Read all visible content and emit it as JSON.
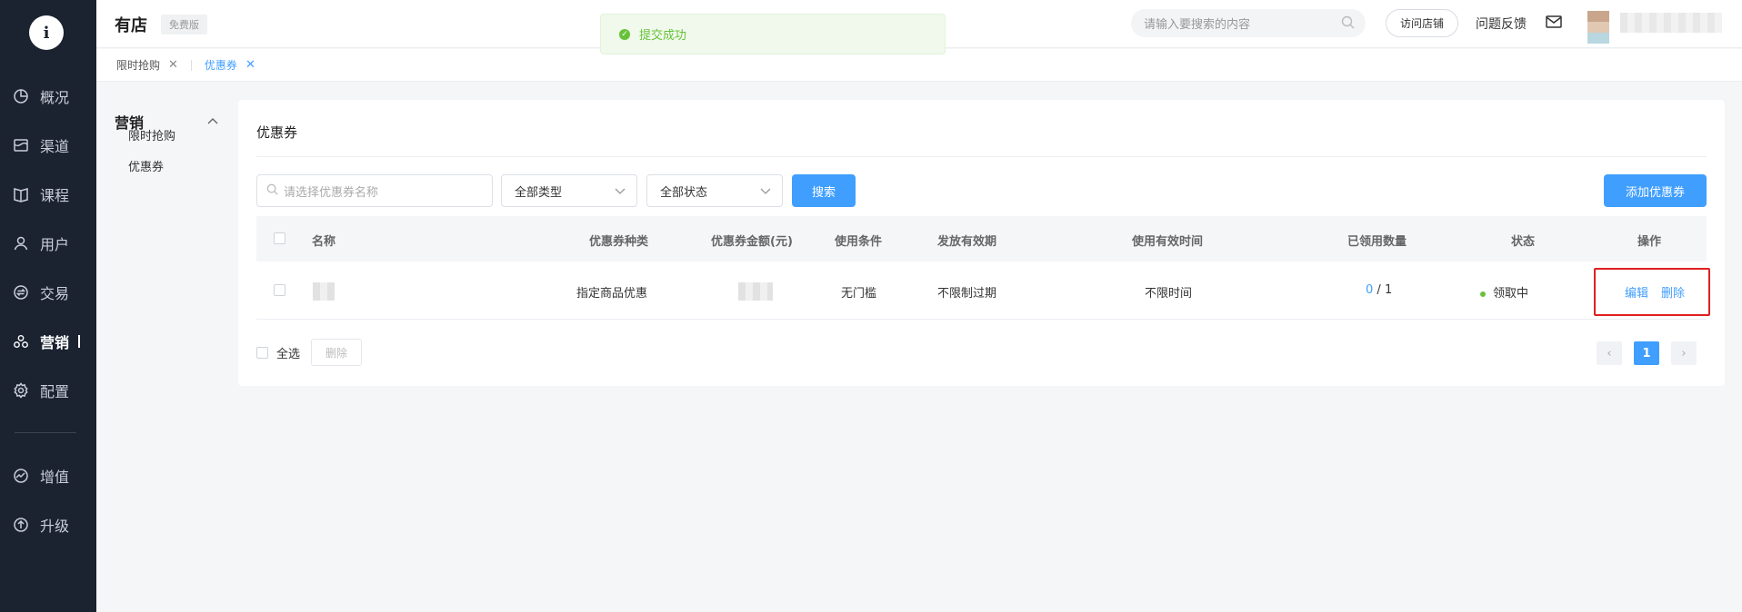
{
  "app": {
    "brand": "有店",
    "plan_badge": "免费版",
    "logo_char": "i"
  },
  "toast": {
    "message": "提交成功",
    "color": "#67c23a"
  },
  "header": {
    "search_placeholder": "请输入要搜索的内容",
    "visit_store_label": "访问店铺",
    "feedback_label": "问题反馈"
  },
  "nav": {
    "items": [
      {
        "label": "概况",
        "icon": "pie-chart-icon"
      },
      {
        "label": "渠道",
        "icon": "store-icon"
      },
      {
        "label": "课程",
        "icon": "book-icon"
      },
      {
        "label": "用户",
        "icon": "user-icon"
      },
      {
        "label": "交易",
        "icon": "exchange-icon"
      },
      {
        "label": "营销",
        "icon": "marketing-icon",
        "active": true
      },
      {
        "label": "配置",
        "icon": "gear-icon"
      },
      {
        "label": "增值",
        "icon": "value-added-icon"
      },
      {
        "label": "升级",
        "icon": "upgrade-icon"
      }
    ]
  },
  "tabs": [
    {
      "label": "限时抢购",
      "active": false
    },
    {
      "label": "优惠券",
      "active": true
    }
  ],
  "subnav": {
    "title": "营销",
    "items": [
      {
        "label": "限时抢购"
      },
      {
        "label": "优惠券"
      }
    ]
  },
  "page": {
    "title": "优惠券",
    "filters": {
      "name_placeholder": "请选择优惠券名称",
      "type_value": "全部类型",
      "status_value": "全部状态",
      "search_label": "搜索",
      "add_label": "添加优惠券"
    },
    "table": {
      "headers": {
        "name": "名称",
        "type": "优惠券种类",
        "amount": "优惠券金额(元)",
        "condition": "使用条件",
        "issue_validity": "发放有效期",
        "use_validity": "使用有效时间",
        "claimed": "已领用数量",
        "status": "状态",
        "actions": "操作"
      },
      "rows": [
        {
          "type": "指定商品优惠",
          "condition": "无门槛",
          "issue_validity": "不限制过期",
          "use_validity": "不限时间",
          "claimed": "0",
          "claimed_sep": " / ",
          "total": "1",
          "status": "领取中",
          "edit_label": "编辑",
          "delete_label": "删除"
        }
      ]
    },
    "footer": {
      "select_all_label": "全选",
      "delete_label": "删除",
      "current_page": "1",
      "prev_glyph": "‹",
      "next_glyph": "›"
    }
  },
  "colors": {
    "primary": "#409eff",
    "nav_bg": "#1b2230",
    "highlight_box": "#e02020"
  }
}
